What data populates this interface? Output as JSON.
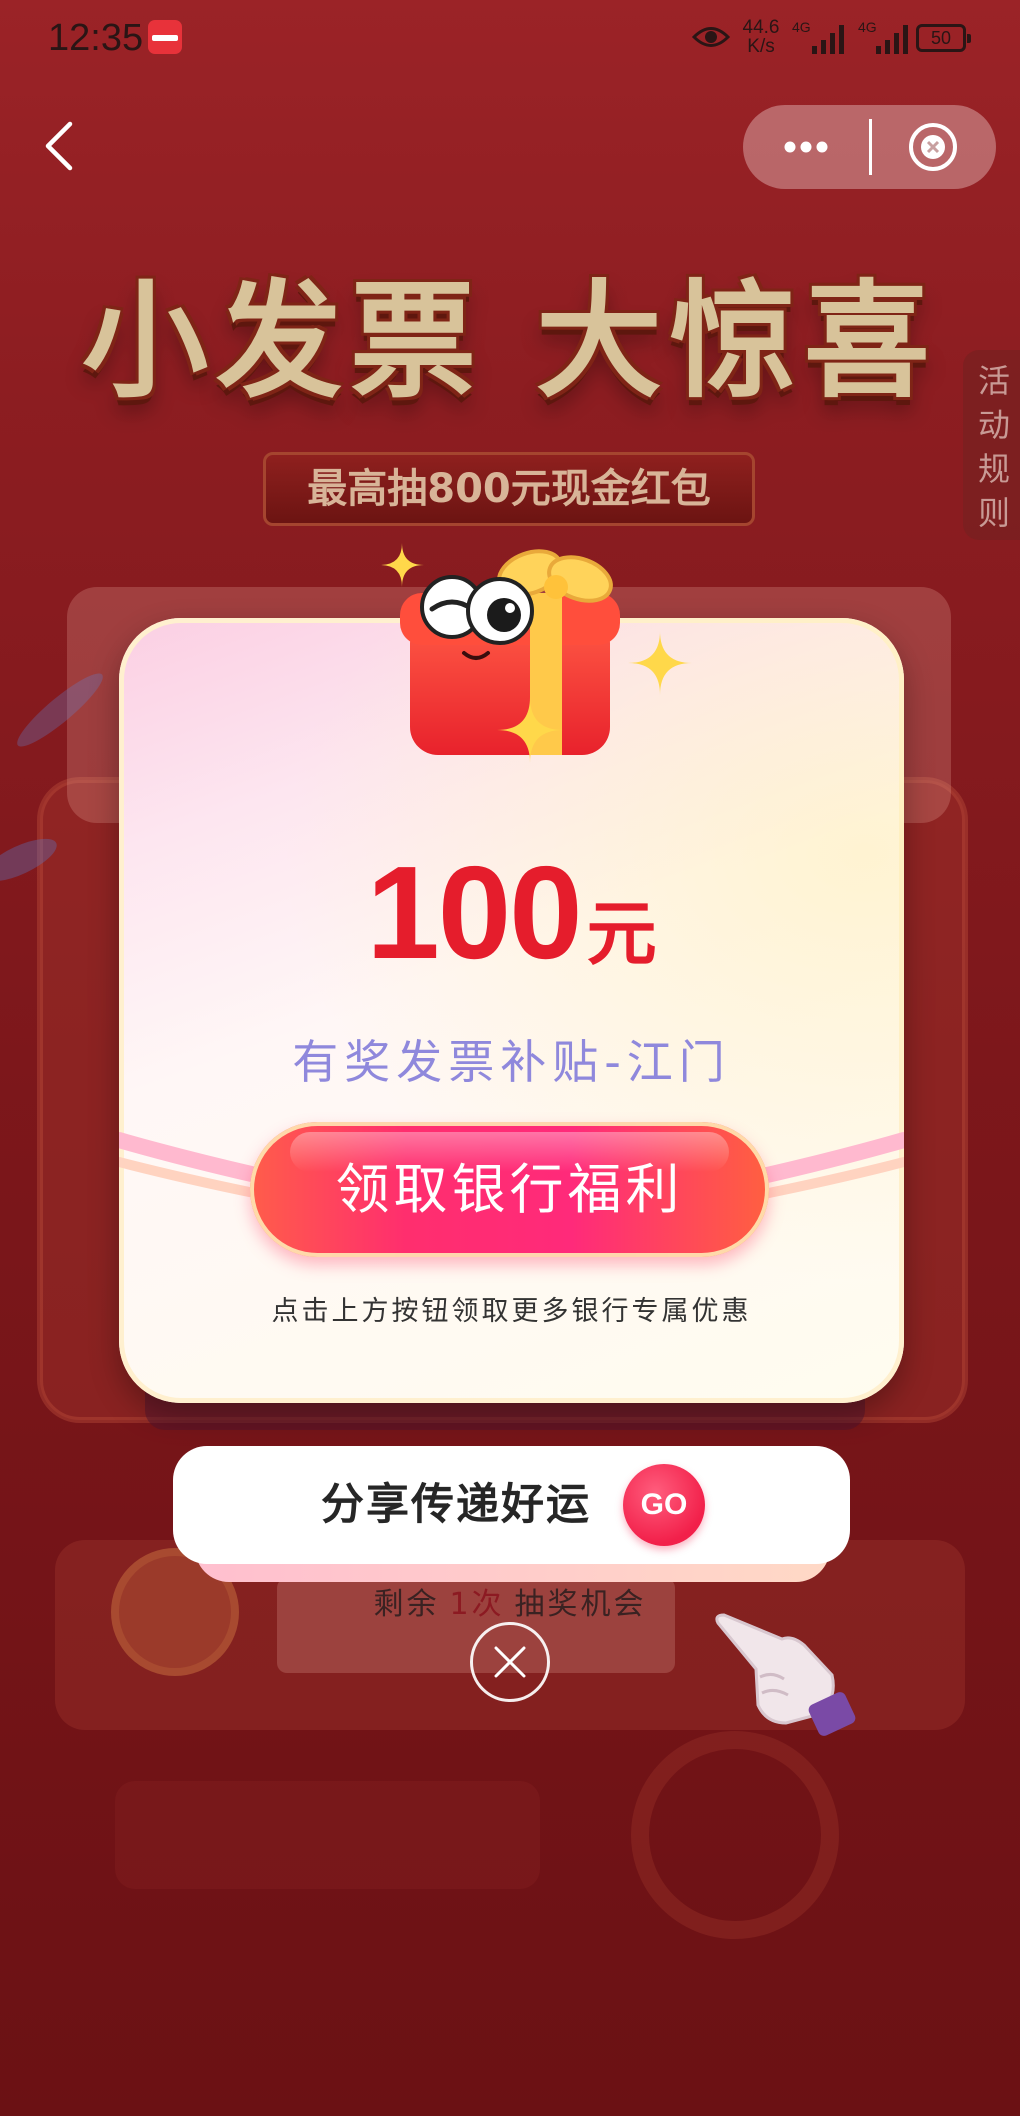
{
  "status_bar": {
    "time": "12:35",
    "app_icon": "app-notification-icon",
    "eye_icon": "eye-icon",
    "net_speed_value": "44.6",
    "net_speed_unit": "K/s",
    "sim1_label": "4G",
    "sim2_label": "4G",
    "battery": "50"
  },
  "nav": {
    "back_icon": "chevron-left-icon",
    "more_icon": "more-dots-icon",
    "close_icon": "close-circle-icon"
  },
  "banner": {
    "title": "小发票 大惊喜",
    "subtitle": "最高抽800元现金红包"
  },
  "side_tab": {
    "label": "活动规则"
  },
  "prize_modal": {
    "gift_icon": "gift-box-icon",
    "amount": "100",
    "unit": "元",
    "prize_name": "有奖发票补贴-江门",
    "claim_button": "领取银行福利",
    "hint": "点击上方按钮领取更多银行专属优惠"
  },
  "share": {
    "label": "分享传递好运",
    "go": "GO"
  },
  "draws": {
    "prefix": "剩余",
    "count": "1次",
    "suffix": "抽奖机会"
  },
  "close_modal": {
    "icon": "close-x-icon"
  },
  "decor": {
    "pointer_icon": "pointer-hand-icon"
  },
  "colors": {
    "background": "#8a1c20",
    "amount_red": "#e51d2c",
    "prize_name_purple": "#8f88dc",
    "button_pink": "#ff2e6e",
    "go_red": "#f2204a"
  }
}
